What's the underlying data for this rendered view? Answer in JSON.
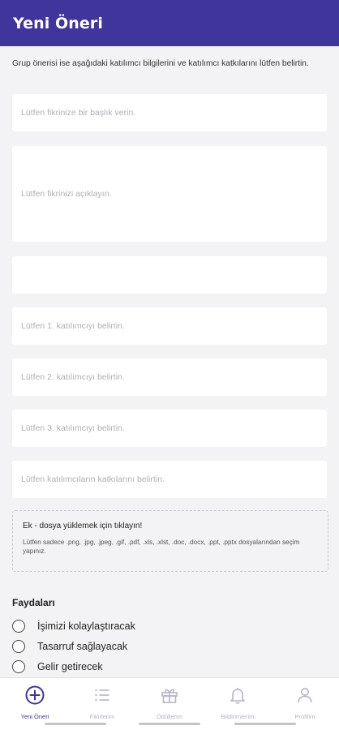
{
  "appbar": {
    "title": "Yeni Öneri"
  },
  "form": {
    "intro": "Grup önerisi ise aşağıdaki katılımcı bilgilerini ve katılımcı katkılarını lütfen belirtin.",
    "title_placeholder": "Lütfen fikrinize bir başlık verin.",
    "description_placeholder": "Lütfen fikrinizi açıklayın.",
    "extra_placeholder": "",
    "participant1_placeholder": "Lütfen 1. katılımcıyı belirtin.",
    "participant2_placeholder": "Lütfen 2. katılımcıyı belirtin.",
    "participant3_placeholder": "Lütfen 3. katılımcıyı belirtin.",
    "contributions_placeholder": "Lütfen katılımcıların katkılarını belirtin."
  },
  "upload": {
    "title": "Ek - dosya yüklemek için tıklayın!",
    "note": "Lütfen sadece .png, .jpg, .jpeg, .gif, .pdf, .xls, .xlst, .doc, .docx, .ppt, .pptx dosyalarından seçim yapınız."
  },
  "benefits": {
    "title": "Faydaları",
    "options": [
      "İşimizi kolaylaştıracak",
      "Tasarruf sağlayacak",
      "Gelir getirecek"
    ]
  },
  "nav": {
    "items": [
      {
        "label": "Yeni Öneri",
        "icon": "add-circle-icon",
        "active": true
      },
      {
        "label": "Fikirlerim",
        "icon": "list-icon",
        "active": false
      },
      {
        "label": "Ödüllerim",
        "icon": "gift-icon",
        "active": false
      },
      {
        "label": "Bildirimlerim",
        "icon": "bell-icon",
        "active": false
      },
      {
        "label": "Profilim",
        "icon": "person-icon",
        "active": false
      }
    ]
  },
  "colors": {
    "primary": "#3f359a",
    "background": "#f3f3f5",
    "inactive_nav": "#b4b4c8"
  }
}
